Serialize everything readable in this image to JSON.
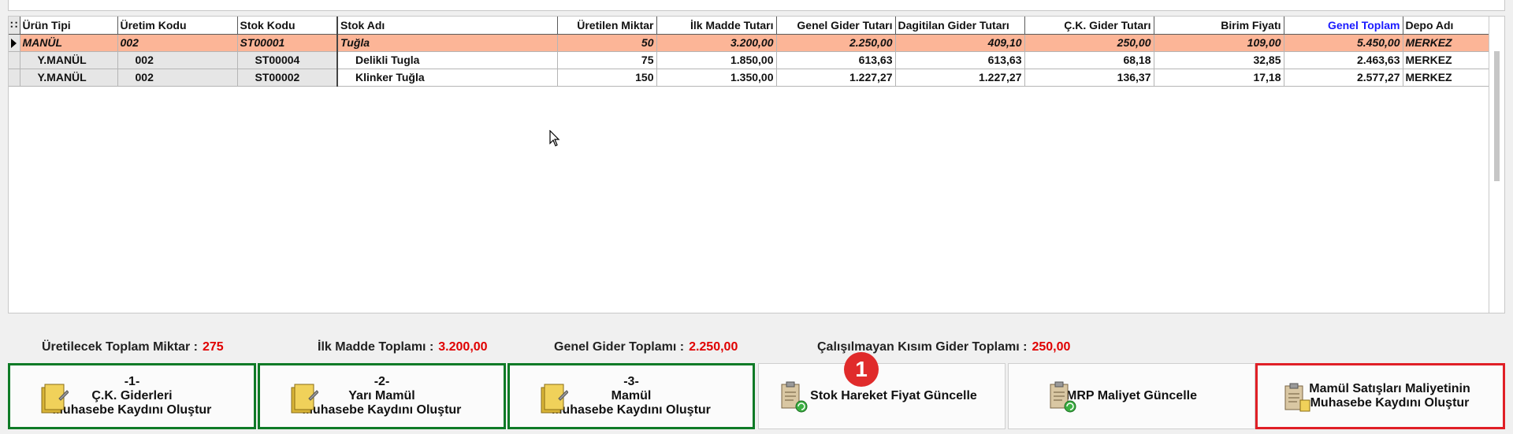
{
  "grid": {
    "columns": [
      {
        "key": "urun_tipi",
        "label": "Ürün Tipi"
      },
      {
        "key": "uretim_kodu",
        "label": "Üretim Kodu"
      },
      {
        "key": "stok_kodu",
        "label": "Stok Kodu"
      },
      {
        "key": "stok_adi",
        "label": "Stok Adı"
      },
      {
        "key": "uretilen_miktar",
        "label": "Üretilen Miktar"
      },
      {
        "key": "ilk_madde",
        "label": "İlk Madde Tutarı"
      },
      {
        "key": "genel_gider",
        "label": "Genel Gider Tutarı"
      },
      {
        "key": "dagitilan_gider",
        "label": "Dagitilan Gider Tutarı"
      },
      {
        "key": "ck_gider",
        "label": "Ç.K. Gider Tutarı"
      },
      {
        "key": "birim_fiyat",
        "label": "Birim Fiyatı"
      },
      {
        "key": "genel_toplam",
        "label": "Genel Toplam"
      },
      {
        "key": "depo_adi",
        "label": "Depo Adı"
      }
    ],
    "rows": [
      [
        "MANÜL",
        "002",
        "ST00001",
        "Tuğla",
        "50",
        "3.200,00",
        "2.250,00",
        "409,10",
        "250,00",
        "109,00",
        "5.450,00",
        "MERKEZ"
      ],
      [
        "Y.MANÜL",
        "002",
        "ST00004",
        "Delikli Tugla",
        "75",
        "1.850,00",
        "613,63",
        "613,63",
        "68,18",
        "32,85",
        "2.463,63",
        "MERKEZ"
      ],
      [
        "Y.MANÜL",
        "002",
        "ST00002",
        "Klinker Tuğla",
        "150",
        "1.350,00",
        "1.227,27",
        "1.227,27",
        "136,37",
        "17,18",
        "2.577,27",
        "MERKEZ"
      ]
    ],
    "selected_row": 0,
    "highlight_column_color": "#1a1aff",
    "selected_row_color": "#fcb597"
  },
  "summary": {
    "total_qty_label": "Üretilecek Toplam Miktar :",
    "total_qty_value": "275",
    "ilk_madde_label": "İlk Madde Toplamı :",
    "ilk_madde_value": "3.200,00",
    "genel_gider_label": "Genel Gider Toplamı :",
    "genel_gider_value": "2.250,00",
    "calisilmayan_label": "Çalışılmayan Kısım Gider Toplamı :",
    "calisilmayan_value": "250,00"
  },
  "buttons": {
    "b1": {
      "line1": "-1-",
      "line2": "Ç.K. Giderleri",
      "line3": "Muhasebe Kaydını Oluştur",
      "icon": "folder-icon"
    },
    "b2": {
      "line1": "-2-",
      "line2": "Yarı Mamül",
      "line3": "Muhasebe Kaydını Oluştur",
      "icon": "folder-icon"
    },
    "b3": {
      "line1": "-3-",
      "line2": "Mamül",
      "line3": "Muhasebe Kaydını Oluştur",
      "icon": "folder-icon"
    },
    "b4": {
      "label": "Stok Hareket Fiyat Güncelle",
      "icon": "clipboard-refresh-icon"
    },
    "b5": {
      "label": "MRP Maliyet Güncelle",
      "icon": "clipboard-refresh-icon"
    },
    "b6": {
      "line1": "Mamül Satışları Maliyetinin",
      "line2": "Muhasebe Kaydını Oluştur",
      "icon": "clipboard-icon"
    }
  },
  "badge": {
    "number": "1"
  },
  "colors": {
    "accent_red": "#e00000",
    "green_border": "#0e7a26",
    "red_border": "#e01f26"
  }
}
